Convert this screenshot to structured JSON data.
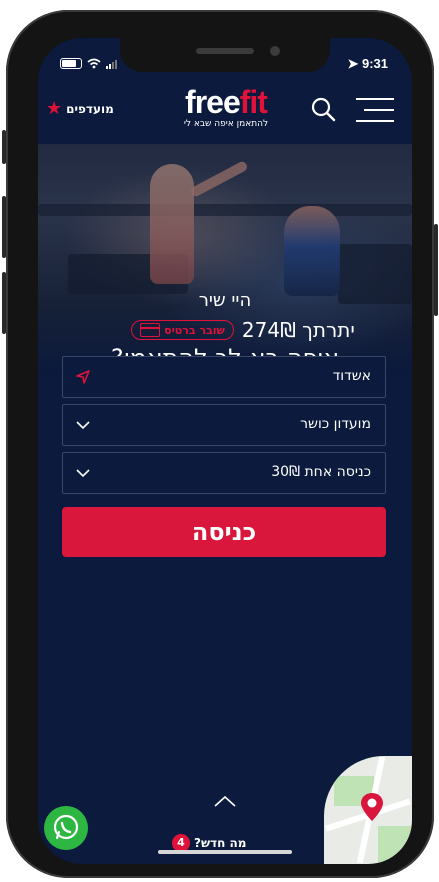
{
  "status_bar": {
    "time": "9:31"
  },
  "header": {
    "favorites_label": "מועדפים",
    "logo_free": "free",
    "logo_fit": "fit",
    "logo_tagline": "להתאמן איפה שבא לי"
  },
  "hero": {
    "greeting": "היי שיר",
    "balance_text": "יתרתך 274₪",
    "card_button_label": "שובר ברטיס",
    "question": "איפה בא לך להתאמן?"
  },
  "form": {
    "city_value": "אשדוד",
    "club_type_value": "מועדון כושר",
    "entry_type_value": "כניסה אחת 30₪",
    "submit_label": "כניסה"
  },
  "footer": {
    "whats_new_label": "מה חדש?",
    "whats_new_count": "4"
  },
  "colors": {
    "background": "#0b1a3d",
    "accent": "#e0123a",
    "button": "#d9173d",
    "whatsapp": "#2db742"
  }
}
